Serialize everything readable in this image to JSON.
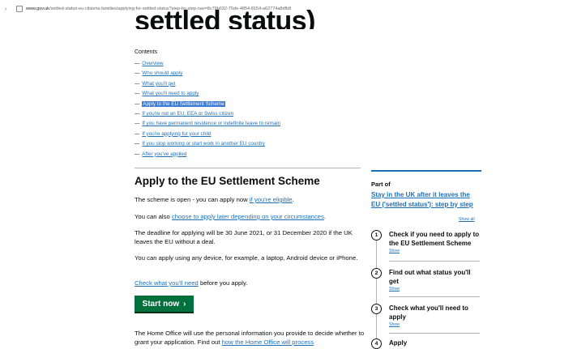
{
  "browser": {
    "url_host": "www.gov.uk",
    "url_path": "/settled-status-eu-citizens-families/applying-for-settled-status?step-by-step-nav=8c79b032-75de-4854-8154-a62774a8dfb8"
  },
  "page": {
    "title": "settled status)"
  },
  "contents": {
    "heading": "Contents",
    "items": [
      "Overview",
      "Who should apply",
      "What you'll get",
      "What you'll need to apply",
      "Apply to the EU Settlement Scheme",
      "If you're not an EU, EEA or Swiss citizen",
      "If you have permanent residence or indefinite leave to remain",
      "If you're applying for your child",
      "If you stop working or start work in another EU country",
      "After you've applied"
    ]
  },
  "article": {
    "heading": "Apply to the EU Settlement Scheme",
    "p1_text": "The scheme is open - you can apply now ",
    "p1_link": "if you're eligible",
    "p1_end": ".",
    "p2_text": "You can also ",
    "p2_link": "choose to apply later depending on your circumstances",
    "p2_end": ".",
    "p3": "The deadline for applying will be 30 June 2021, or 31 December 2020 if the UK leaves the EU without a deal.",
    "p4": "You can apply using any device, for example, a laptop, Android device or iPhone.",
    "p5_link": "Check what you'll need",
    "p5_text": " before you apply.",
    "start_button": "Start now",
    "start_chevron": "›",
    "p6_text": "The Home Office will use the personal information you provide to decide whether to grant your application. Find out ",
    "p6_link": "how the Home Office will process"
  },
  "sidebar": {
    "part_of": "Part of",
    "link": "Stay in the UK after it leaves the EU ('settled status'): step by step",
    "show_all": "Show all",
    "steps": [
      {
        "num": "1",
        "label": "Check if you need to apply to the EU Settlement Scheme",
        "show": "Show"
      },
      {
        "num": "2",
        "label": "Find out what status you'll get",
        "show": "Show"
      },
      {
        "num": "3",
        "label": "Check what you'll need to apply",
        "show": "Show"
      },
      {
        "num": "4",
        "label": "Apply",
        "show": ""
      }
    ]
  }
}
